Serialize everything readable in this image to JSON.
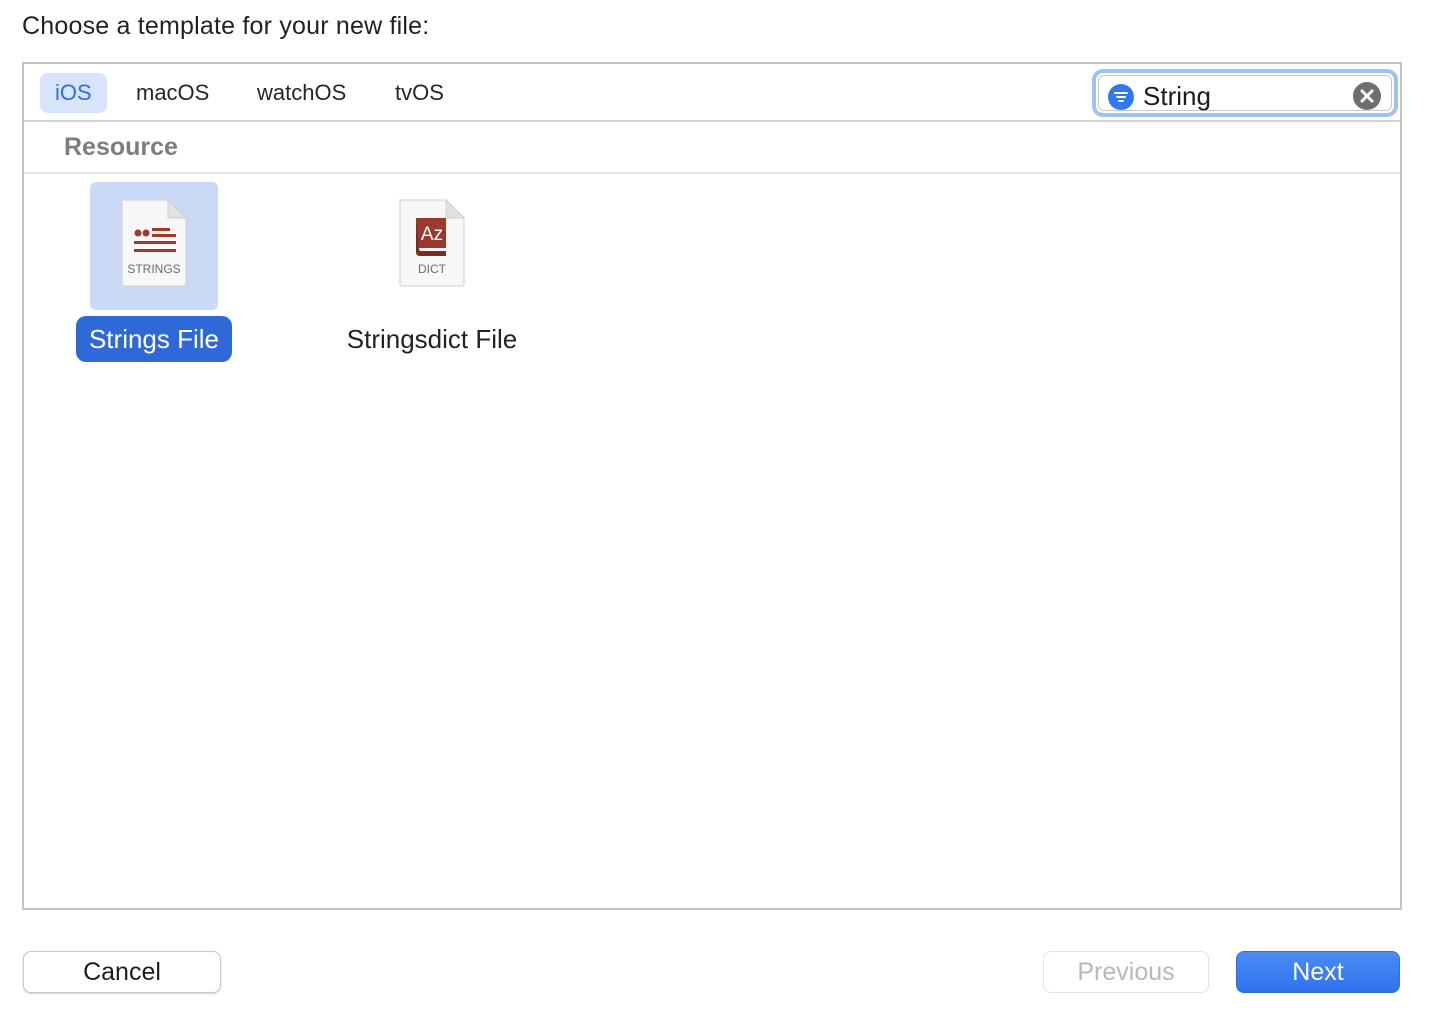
{
  "dialog": {
    "heading": "Choose a template for your new file:"
  },
  "platform_tabs": [
    {
      "label": "iOS",
      "selected": true
    },
    {
      "label": "macOS",
      "selected": false
    },
    {
      "label": "watchOS",
      "selected": false
    },
    {
      "label": "tvOS",
      "selected": false
    }
  ],
  "filter": {
    "value": "String",
    "icon": "filter-icon",
    "clear_icon": "clear-icon"
  },
  "section": {
    "title": "Resource"
  },
  "templates": [
    {
      "label": "Strings File",
      "icon_badge": "STRINGS",
      "icon": "strings-file-icon",
      "selected": true
    },
    {
      "label": "Stringsdict File",
      "icon_badge": "DICT",
      "icon_glyph": "Az",
      "icon": "stringsdict-file-icon",
      "selected": false
    }
  ],
  "buttons": {
    "cancel": "Cancel",
    "previous": "Previous",
    "next": "Next"
  },
  "colors": {
    "accent": "#2f68d8",
    "selected_tab_bg": "#d6e5fb",
    "selected_tab_text": "#2f6fe0",
    "icon_glyph": "#9b3a2c"
  }
}
